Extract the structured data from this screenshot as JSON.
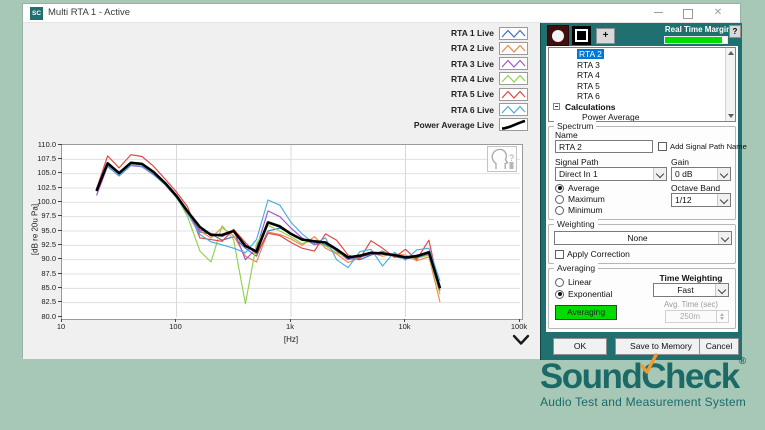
{
  "window": {
    "title": "Multi RTA 1 - Active",
    "icon_text": "SC"
  },
  "chart": {
    "ylabel": "[dB re 20u Pa]",
    "xlabel": "[Hz]",
    "yticks": [
      "110.0",
      "107.5",
      "105.0",
      "102.5",
      "100.0",
      "97.5",
      "95.0",
      "92.5",
      "90.0",
      "87.5",
      "85.0",
      "82.5",
      "80.0"
    ],
    "xticks": [
      {
        "label": "10",
        "f": 10
      },
      {
        "label": "100",
        "f": 100
      },
      {
        "label": "1k",
        "f": 1000
      },
      {
        "label": "10k",
        "f": 10000
      },
      {
        "label": "100k",
        "f": 100000
      }
    ],
    "chart_data": {
      "type": "line",
      "x_scale": "log",
      "xlim": [
        10,
        100000
      ],
      "ylim": [
        80,
        110
      ],
      "grid": true,
      "frequencies_hz": [
        20,
        25,
        31.5,
        40,
        50,
        63,
        80,
        100,
        125,
        160,
        200,
        250,
        315,
        400,
        500,
        630,
        800,
        1000,
        1250,
        1600,
        2000,
        2500,
        3150,
        4000,
        5000,
        6300,
        8000,
        10000,
        12500,
        16000,
        20000
      ],
      "series": [
        {
          "name": "RTA 1",
          "legend": "RTA 1 Live",
          "color": "#3b6fc9",
          "thick": false,
          "values": [
            102.0,
            106.6,
            105.0,
            106.8,
            106.6,
            105.2,
            103.3,
            101.1,
            98.4,
            94.8,
            94.5,
            93.4,
            94.0,
            92.0,
            90.6,
            95.0,
            95.5,
            94.6,
            93.5,
            93.0,
            92.6,
            91.8,
            90.2,
            90.0,
            90.8,
            91.5,
            90.5,
            90.2,
            90.3,
            91.0,
            85.5
          ]
        },
        {
          "name": "RTA 2",
          "legend": "RTA 2 Live",
          "color": "#f58548",
          "thick": false,
          "values": [
            102.1,
            106.8,
            105.1,
            106.9,
            106.7,
            105.3,
            103.4,
            101.2,
            98.5,
            95.0,
            93.8,
            95.6,
            94.2,
            90.6,
            89.6,
            94.8,
            94.4,
            93.6,
            92.5,
            94.0,
            92.0,
            91.0,
            89.5,
            90.3,
            91.2,
            90.6,
            91.0,
            90.8,
            89.8,
            90.5,
            82.6
          ]
        },
        {
          "name": "RTA 3",
          "legend": "RTA 3 Live",
          "color": "#a156c8",
          "thick": false,
          "values": [
            101.2,
            106.3,
            104.6,
            106.4,
            106.2,
            104.8,
            103.1,
            100.9,
            98.2,
            95.2,
            94.6,
            94.0,
            95.2,
            90.0,
            92.0,
            98.5,
            97.5,
            95.5,
            93.8,
            92.6,
            93.0,
            91.5,
            90.0,
            90.5,
            90.9,
            91.0,
            90.6,
            90.3,
            90.8,
            91.2,
            85.2
          ]
        },
        {
          "name": "RTA 4",
          "legend": "RTA 4 Live",
          "color": "#8fd24a",
          "thick": false,
          "values": [
            102.0,
            106.9,
            105.2,
            107.0,
            106.8,
            105.4,
            103.2,
            101.0,
            97.5,
            91.5,
            89.6,
            95.9,
            93.5,
            82.3,
            92.8,
            96.0,
            95.0,
            94.0,
            92.8,
            93.4,
            92.4,
            91.2,
            90.4,
            90.7,
            91.1,
            91.3,
            90.9,
            90.5,
            90.2,
            90.8,
            84.0
          ]
        },
        {
          "name": "RTA 5",
          "legend": "RTA 5 Live",
          "color": "#e04343",
          "thick": false,
          "values": [
            102.3,
            108.1,
            106.0,
            108.3,
            108.0,
            106.3,
            104.0,
            101.8,
            99.2,
            93.8,
            93.5,
            93.2,
            95.3,
            93.0,
            91.0,
            94.6,
            94.2,
            93.0,
            92.0,
            91.5,
            94.5,
            93.4,
            90.8,
            90.2,
            93.3,
            92.0,
            90.4,
            91.8,
            90.0,
            93.4,
            84.6
          ]
        },
        {
          "name": "RTA 6",
          "legend": "RTA 6 Live",
          "color": "#49abe2",
          "thick": false,
          "values": [
            101.9,
            106.2,
            104.7,
            106.5,
            106.3,
            104.9,
            103.0,
            100.8,
            98.0,
            94.4,
            93.1,
            92.6,
            92.0,
            91.2,
            93.5,
            100.4,
            99.5,
            96.5,
            94.5,
            92.8,
            93.8,
            90.0,
            88.6,
            91.4,
            91.8,
            88.9,
            91.3,
            89.9,
            91.7,
            92.0,
            86.3
          ]
        },
        {
          "name": "Power Average",
          "legend": "Power Average  Live",
          "color": "#000000",
          "thick": true,
          "values": [
            102.0,
            106.8,
            105.1,
            106.9,
            106.7,
            105.3,
            103.3,
            101.1,
            98.4,
            95.7,
            94.3,
            94.3,
            95.0,
            92.4,
            91.4,
            96.5,
            95.8,
            94.5,
            93.5,
            93.2,
            93.0,
            91.8,
            90.4,
            90.7,
            91.2,
            91.1,
            90.8,
            90.4,
            90.6,
            91.3,
            85.0
          ]
        }
      ]
    }
  },
  "panel": {
    "margin_label": "Real Time Margin",
    "margin_fill_pct": 92,
    "help_label": "?",
    "add_label": "+",
    "tree": [
      {
        "label": "RTA 2",
        "indent": 28,
        "selected": true,
        "bold": false,
        "expander": false
      },
      {
        "label": "RTA 3",
        "indent": 28,
        "selected": false,
        "bold": false,
        "expander": false
      },
      {
        "label": "RTA 4",
        "indent": 28,
        "selected": false,
        "bold": false,
        "expander": false
      },
      {
        "label": "RTA 5",
        "indent": 28,
        "selected": false,
        "bold": false,
        "expander": false
      },
      {
        "label": "RTA 6",
        "indent": 28,
        "selected": false,
        "bold": false,
        "expander": false
      },
      {
        "label": "Calculations",
        "indent": 16,
        "selected": false,
        "bold": true,
        "expander": true
      },
      {
        "label": "Power Average",
        "indent": 33,
        "selected": false,
        "bold": false,
        "expander": false
      }
    ],
    "spectrum": {
      "title": "Spectrum",
      "name_label": "Name",
      "name_value": "RTA 2",
      "add_checkbox_label": "Add Signal Path Name",
      "signal_path_label": "Signal Path",
      "signal_path_value": "Direct In 1",
      "gain_label": "Gain",
      "gain_value": "0 dB",
      "mode_options": [
        "Average",
        "Maximum",
        "Minimum"
      ],
      "mode_selected": "Average",
      "octave_label": "Octave Band",
      "octave_value": "1/12"
    },
    "weighting": {
      "title": "Weighting",
      "value": "None",
      "apply_label": "Apply Correction"
    },
    "averaging": {
      "title": "Averaging",
      "options": [
        "Linear",
        "Exponential"
      ],
      "selected": "Exponential",
      "time_weighting_label": "Time Weighting",
      "time_weighting_value": "Fast",
      "avg_time_label": "Avg. Time (sec)",
      "avg_time_value": "250m",
      "button_label": "Averaging"
    },
    "footer": {
      "ok": "OK",
      "save": "Save to Memory",
      "cancel": "Cancel"
    }
  },
  "logo": {
    "pre": "Sound",
    "c": "C",
    "post": "heck",
    "registered": "®",
    "tagline": "Audio Test and Measurement System",
    "brand_color": "#1b6a68",
    "check_color": "#f0992e"
  }
}
